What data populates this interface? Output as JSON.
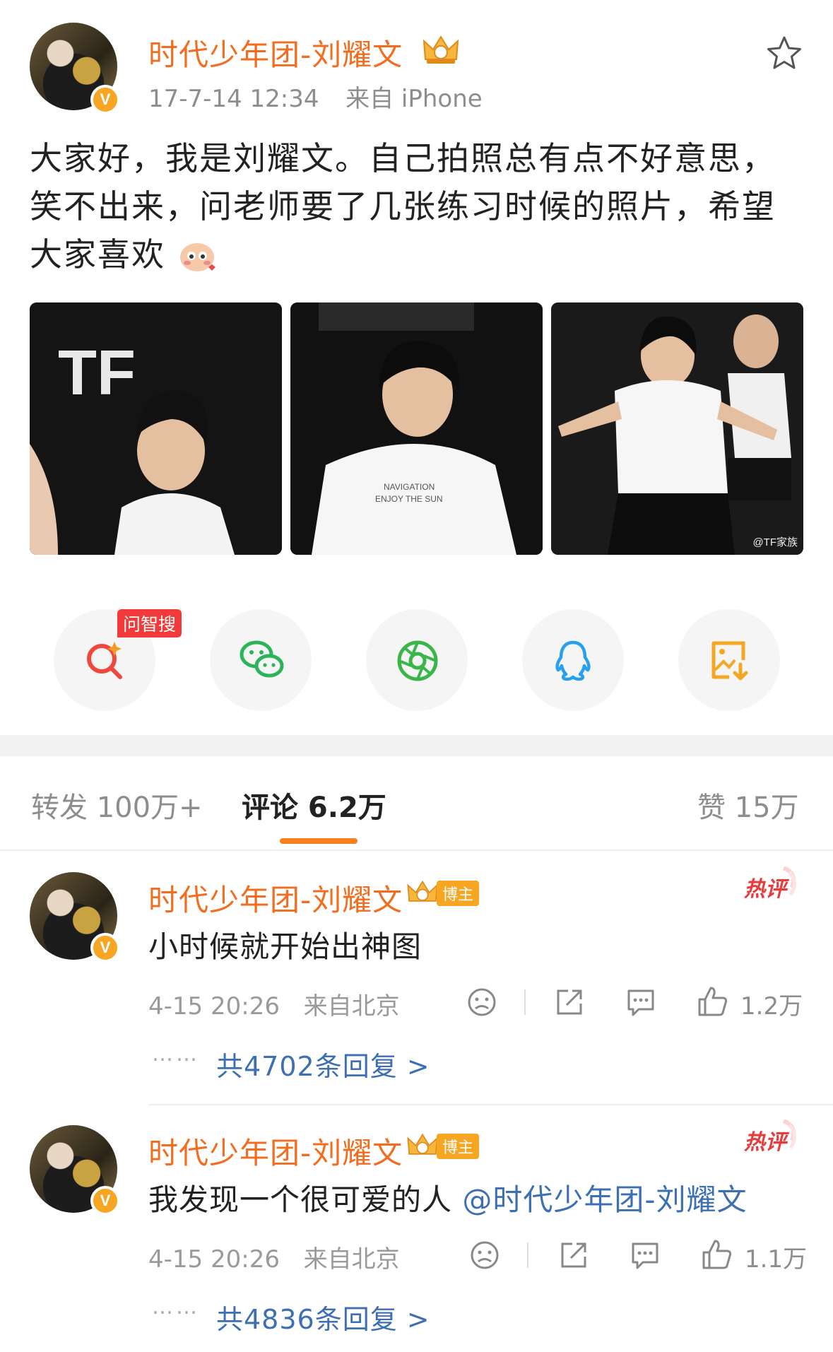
{
  "post": {
    "author": "时代少年团-刘耀文",
    "timestamp": "17-7-14 12:34",
    "source": "来自 iPhone",
    "text": "大家好，我是刘耀文。自己拍照总有点不好意思，笑不出来，问老师要了几张练习时候的照片，希望大家喜欢",
    "verified_badge": "V",
    "photo_watermark": "@TF家族"
  },
  "share": {
    "ai_tag": "问智搜",
    "buttons": [
      "ai-search-icon",
      "wechat-icon",
      "moments-icon",
      "qq-icon",
      "save-image-icon"
    ]
  },
  "tabs": {
    "repost": "转发 100万+",
    "comments": "评论 6.2万",
    "likes": "赞 15万"
  },
  "comments": [
    {
      "author": "时代少年团-刘耀文",
      "badge": "博主",
      "hot_label": "热评",
      "text": "小时候就开始出神图",
      "time": "4-15 20:26",
      "location": "来自北京",
      "likes": "1.2万",
      "replies": "共4702条回复 >"
    },
    {
      "author": "时代少年团-刘耀文",
      "badge": "博主",
      "hot_label": "热评",
      "text": "我发现一个很可爱的人 ",
      "mention": "@时代少年团-刘耀文",
      "time": "4-15 20:26",
      "location": "来自北京",
      "likes": "1.1万",
      "replies": "共4836条回复 >"
    }
  ],
  "colors": {
    "name": "#f26d1f",
    "link": "#3d6fb3",
    "accent": "#f5821f",
    "badge": "#f6a623"
  }
}
